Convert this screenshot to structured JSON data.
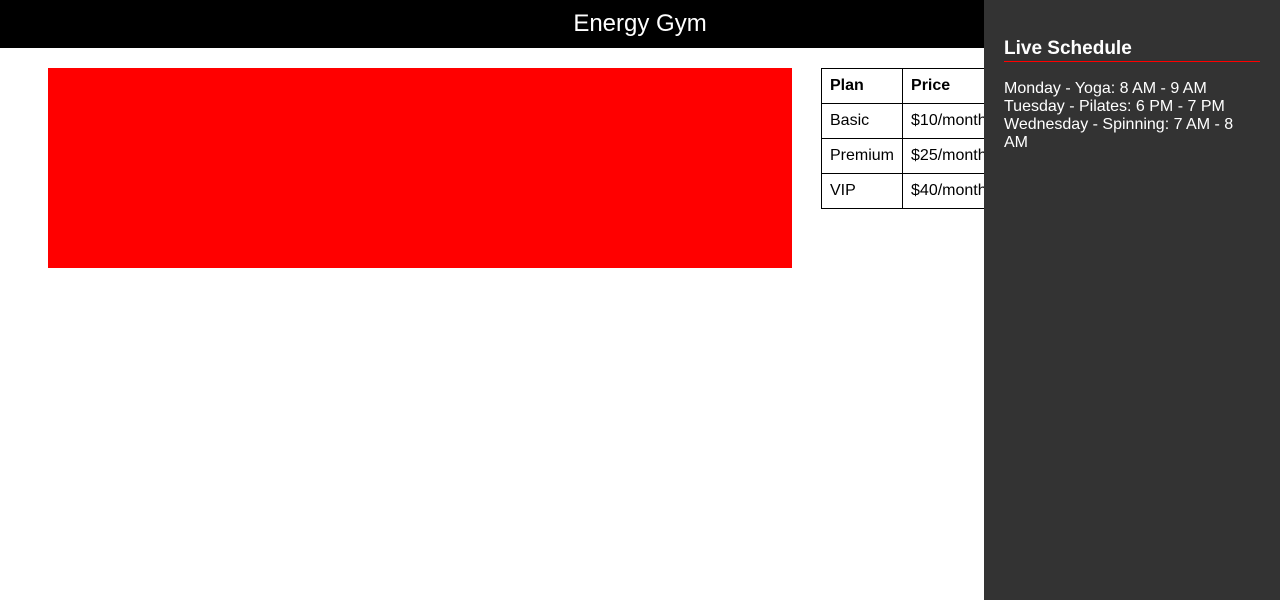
{
  "header": {
    "title": "Energy Gym"
  },
  "banner": {
    "color": "#ff0000"
  },
  "pricing": {
    "headers": [
      "Plan",
      "Price"
    ],
    "rows": [
      [
        "Basic",
        "$10/month"
      ],
      [
        "Premium",
        "$25/month"
      ],
      [
        "VIP",
        "$40/month"
      ]
    ]
  },
  "sidebar": {
    "title": "Live Schedule",
    "accent_color": "#ff0000",
    "background_color": "#333333",
    "items": [
      "Monday - Yoga: 8 AM - 9 AM",
      "Tuesday - Pilates: 6 PM - 7 PM",
      "Wednesday - Spinning: 7 AM - 8 AM"
    ]
  }
}
